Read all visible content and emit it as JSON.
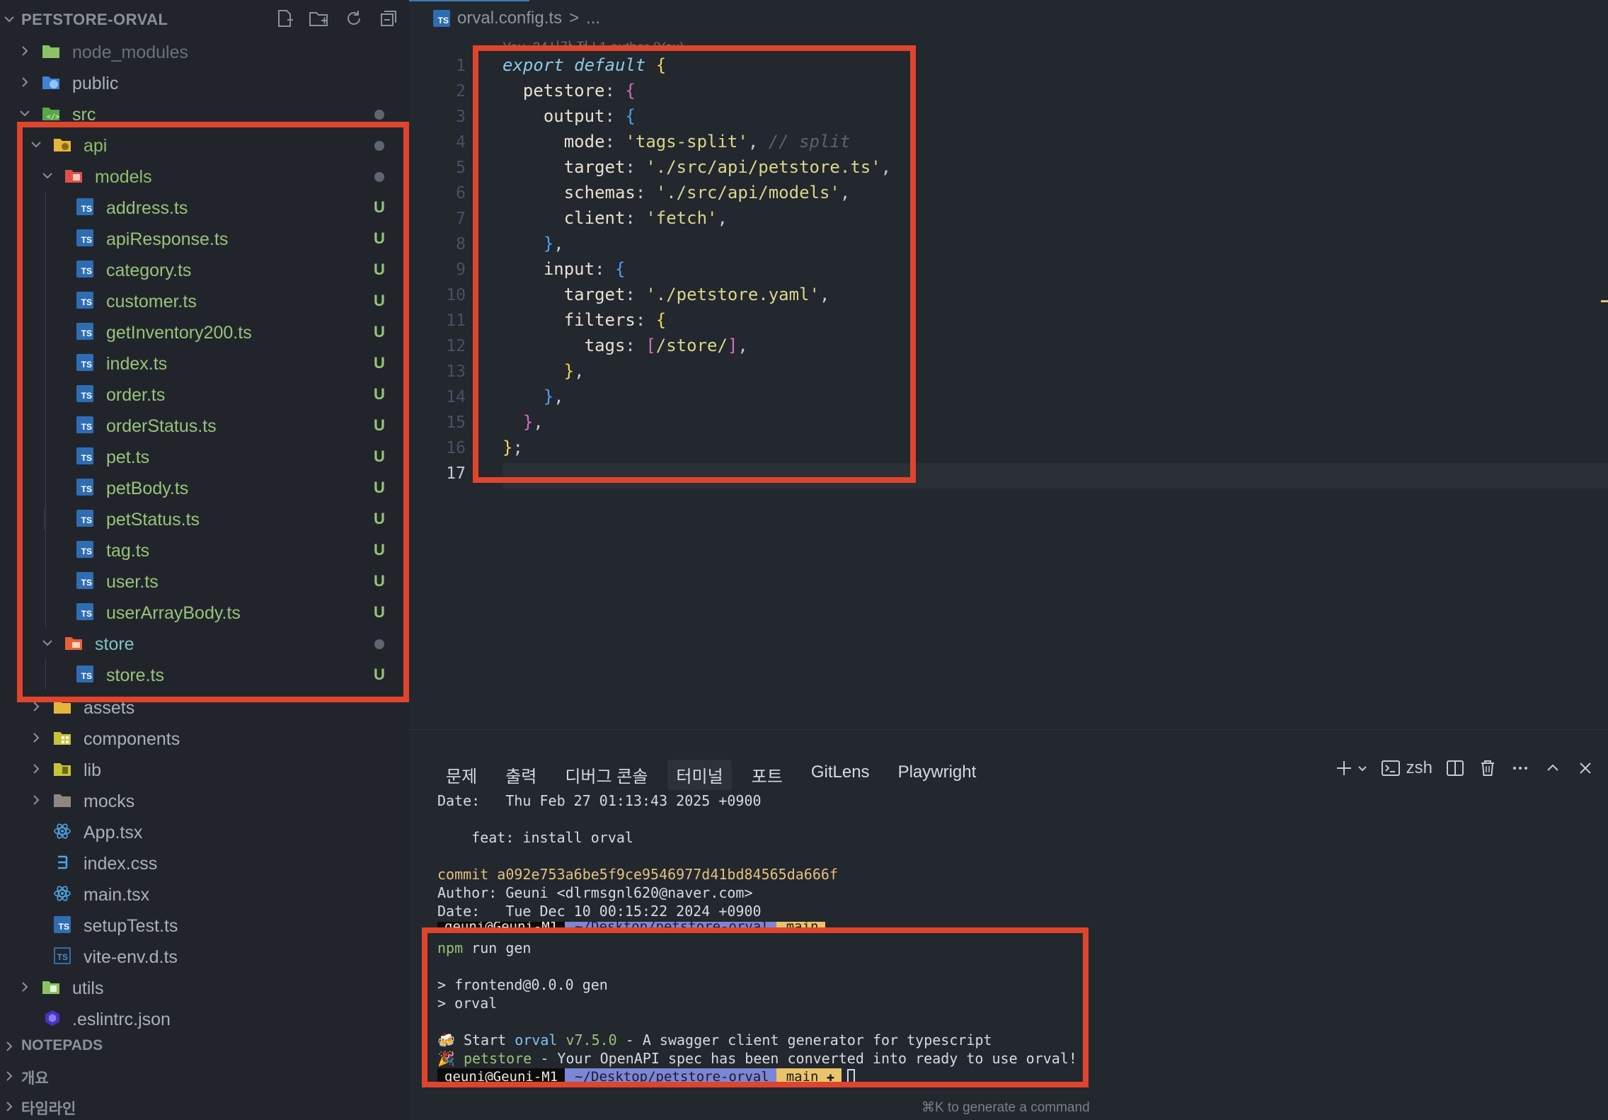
{
  "sidebar": {
    "title": "PETSTORE-ORVAL",
    "actions": [
      "new-file-icon",
      "new-folder-icon",
      "refresh-icon",
      "collapse-all-icon"
    ],
    "tree": [
      {
        "name": "node_modules",
        "icon": "folder-node-icon"
      },
      {
        "name": "public",
        "icon": "folder-public-icon"
      },
      {
        "name": "src",
        "icon": "folder-src-icon"
      },
      {
        "name": "api",
        "icon": "folder-api-icon"
      },
      {
        "name": "models",
        "icon": "folder-models-icon"
      },
      {
        "name": "address.ts",
        "status": "U"
      },
      {
        "name": "apiResponse.ts",
        "status": "U"
      },
      {
        "name": "category.ts",
        "status": "U"
      },
      {
        "name": "customer.ts",
        "status": "U"
      },
      {
        "name": "getInventory200.ts",
        "status": "U"
      },
      {
        "name": "index.ts",
        "status": "U"
      },
      {
        "name": "order.ts",
        "status": "U"
      },
      {
        "name": "orderStatus.ts",
        "status": "U"
      },
      {
        "name": "pet.ts",
        "status": "U"
      },
      {
        "name": "petBody.ts",
        "status": "U"
      },
      {
        "name": "petStatus.ts",
        "status": "U"
      },
      {
        "name": "tag.ts",
        "status": "U"
      },
      {
        "name": "user.ts",
        "status": "U"
      },
      {
        "name": "userArrayBody.ts",
        "status": "U"
      },
      {
        "name": "store",
        "icon": "folder-store-icon"
      },
      {
        "name": "store.ts",
        "status": "U"
      },
      {
        "name": "assets",
        "icon": "folder-assets-icon"
      },
      {
        "name": "components",
        "icon": "folder-components-icon"
      },
      {
        "name": "lib",
        "icon": "folder-lib-icon"
      },
      {
        "name": "mocks",
        "icon": "folder-mocks-icon"
      },
      {
        "name": "App.tsx",
        "icon": "react-icon"
      },
      {
        "name": "index.css",
        "icon": "css-icon"
      },
      {
        "name": "main.tsx",
        "icon": "react-icon"
      },
      {
        "name": "setupTest.ts",
        "icon": "typescript-icon"
      },
      {
        "name": "vite-env.d.ts",
        "icon": "typescript-def-icon"
      },
      {
        "name": "utils",
        "icon": "folder-utils-icon"
      },
      {
        "name": ".eslintrc.json",
        "icon": "eslint-icon"
      }
    ],
    "file_status_label": "U",
    "sections": [
      "NOTEPADS",
      "개요",
      "타임라인"
    ]
  },
  "editor": {
    "tab_label": "orval.config.ts",
    "breadcrumb_sep": ">",
    "breadcrumb_more": "...",
    "blame": "You, 24시간 전 | 1 author (You)",
    "line_numbers": [
      "1",
      "2",
      "3",
      "4",
      "5",
      "6",
      "7",
      "8",
      "9",
      "10",
      "11",
      "12",
      "13",
      "14",
      "15",
      "16",
      "17"
    ],
    "code": [
      "export default {",
      "  petstore: {",
      "    output: {",
      "      mode: 'tags-split', // split",
      "      target: './src/api/petstore.ts',",
      "      schemas: './src/api/models',",
      "      client: 'fetch',",
      "    },",
      "    input: {",
      "      target: './petstore.yaml',",
      "      filters: {",
      "        tags: [/store/],",
      "      },",
      "    },",
      "  },",
      "};",
      ""
    ]
  },
  "panel": {
    "tabs": [
      "문제",
      "출력",
      "디버그 콘솔",
      "터미널",
      "포트",
      "GitLens",
      "Playwright"
    ],
    "active_tab": "터미널",
    "shell": "zsh",
    "terminal": {
      "date1": "Date:   Thu Feb 27 01:13:43 2025 +0900",
      "msg1": "    feat: install orval",
      "commit_label": "commit",
      "commit_hash": "a092e753a6be5f9ce9546977d41bd84565da666f",
      "author": "Author: Geuni <dlrmsgnl620@naver.com>",
      "date2": "Date:   Tue Dec 10 00:15:22 2024 +0900",
      "prompt_user": "geuni@Geuni-M1",
      "prompt_path": "~/Desktop/petstore-orval",
      "prompt_branch": "main",
      "prompt_branch_dirty": "main ✚",
      "cmd_npm": "npm",
      "cmd_rest": " run gen",
      "out1": "> frontend@0.0.0 gen",
      "out2": "> orval",
      "start_emoji": "🍻",
      "start_pre": " Start ",
      "start_orval": "orval",
      "start_version": "v7.5.0",
      "start_post": " - A swagger client generator for typescript",
      "done_emoji": "🎉",
      "done_name": "petstore",
      "done_post": " - Your OpenAPI spec has been converted into ready to use orval!"
    },
    "hint": "⌘K to generate a command"
  },
  "colors": {
    "highlight_box": "#e0442c",
    "ts_badge": "#2f6db3",
    "untracked": "#98c379"
  }
}
